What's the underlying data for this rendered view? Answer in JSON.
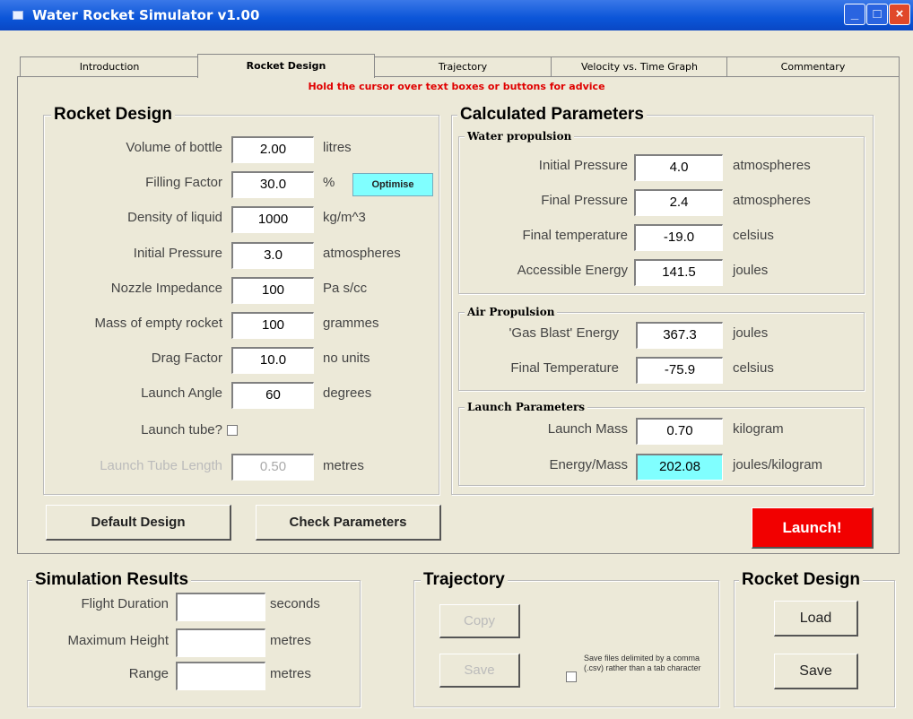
{
  "window": {
    "title": "Water Rocket Simulator v1.00"
  },
  "tabs": [
    "Introduction",
    "Rocket Design",
    "Trajectory",
    "Velocity vs. Time Graph",
    "Commentary"
  ],
  "advice": "Hold the cursor over text boxes or buttons for advice",
  "rocket_design": {
    "title": "Rocket Design",
    "rows": [
      {
        "label": "Volume of bottle",
        "value": "2.00",
        "unit": "litres"
      },
      {
        "label": "Filling Factor",
        "value": "30.0",
        "unit": "%"
      },
      {
        "label": "Density of liquid",
        "value": "1000",
        "unit": "kg/m^3"
      },
      {
        "label": "Initial Pressure",
        "value": "3.0",
        "unit": "atmospheres"
      },
      {
        "label": "Nozzle Impedance",
        "value": "100",
        "unit": "Pa s/cc"
      },
      {
        "label": "Mass of empty rocket",
        "value": "100",
        "unit": "grammes"
      },
      {
        "label": "Drag Factor",
        "value": "10.0",
        "unit": "no units"
      },
      {
        "label": "Launch Angle",
        "value": "60",
        "unit": "degrees"
      }
    ],
    "optimise_label": "Optimise",
    "launch_tube_label": "Launch tube?",
    "launch_tube_length": {
      "label": "Launch Tube Length",
      "value": "0.50",
      "unit": "metres"
    }
  },
  "calculated": {
    "title": "Calculated Parameters",
    "water": {
      "title": "Water propulsion",
      "rows": [
        {
          "label": "Initial Pressure",
          "value": "4.0",
          "unit": "atmospheres"
        },
        {
          "label": "Final Pressure",
          "value": "2.4",
          "unit": "atmospheres"
        },
        {
          "label": "Final temperature",
          "value": "-19.0",
          "unit": "celsius"
        },
        {
          "label": "Accessible Energy",
          "value": "141.5",
          "unit": "joules"
        }
      ]
    },
    "air": {
      "title": "Air Propulsion",
      "rows": [
        {
          "label": "'Gas Blast' Energy",
          "value": "367.3",
          "unit": "joules"
        },
        {
          "label": "Final Temperature",
          "value": "-75.9",
          "unit": "celsius"
        }
      ]
    },
    "launch": {
      "title": "Launch Parameters",
      "rows": [
        {
          "label": "Launch Mass",
          "value": "0.70",
          "unit": "kilogram"
        },
        {
          "label": "Energy/Mass",
          "value": "202.08",
          "unit": "joules/kilogram"
        }
      ]
    }
  },
  "buttons": {
    "default_design": "Default Design",
    "check_parameters": "Check Parameters",
    "launch": "Launch!"
  },
  "simulation": {
    "title": "Simulation Results",
    "rows": [
      {
        "label": "Flight Duration",
        "value": "",
        "unit": "seconds"
      },
      {
        "label": "Maximum Height",
        "value": "",
        "unit": "metres"
      },
      {
        "label": "Range",
        "value": "",
        "unit": "metres"
      }
    ]
  },
  "trajectory": {
    "title": "Trajectory",
    "copy": "Copy",
    "save": "Save",
    "csv_note": "Save files delimited by a comma (.csv) rather than a tab character"
  },
  "rocket_file": {
    "title": "Rocket Design",
    "load": "Load",
    "save": "Save"
  }
}
